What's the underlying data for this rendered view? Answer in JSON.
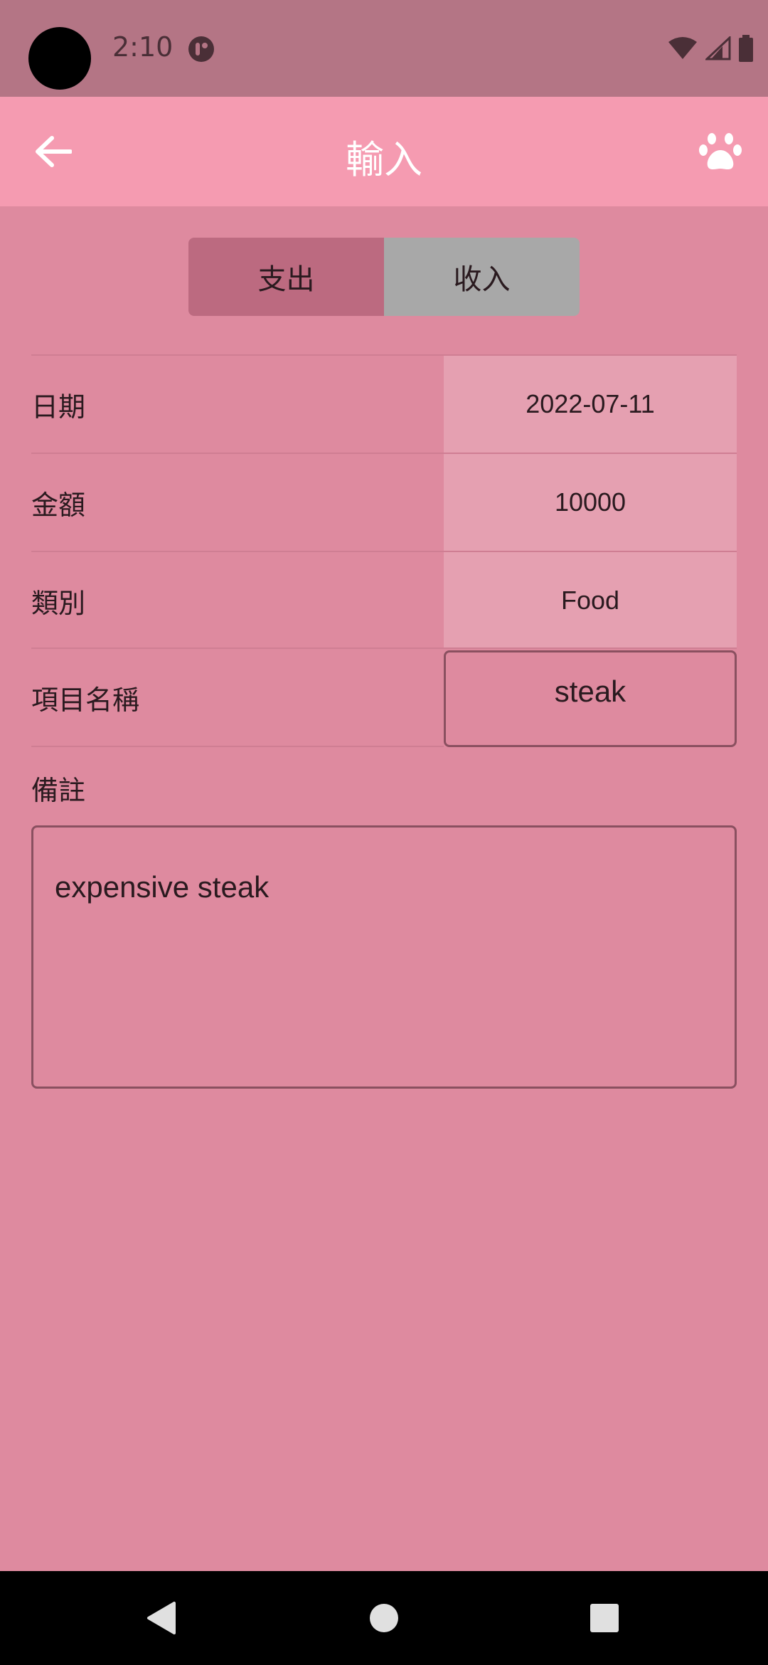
{
  "status_bar": {
    "time": "2:10"
  },
  "app_bar": {
    "title": "輸入",
    "back_icon": "arrow-left-icon",
    "right_icon": "paw-icon"
  },
  "segment": {
    "options": [
      "支出",
      "收入"
    ],
    "selected": "支出"
  },
  "form": {
    "rows": [
      {
        "label": "日期",
        "value": "2022-07-11"
      },
      {
        "label": "金額",
        "value": "10000"
      },
      {
        "label": "類別",
        "value": "Food"
      },
      {
        "label": "項目名稱",
        "value": "steak"
      }
    ],
    "note_label": "備註",
    "note_value": "expensive steak"
  },
  "colors": {
    "status_bar": "#b47585",
    "app_bar": "#f59bb1",
    "background": "#de8a9f",
    "segment_active": "#bc6a80",
    "segment_inactive": "#a8a8a8",
    "value_cell": "#e5a0b1"
  }
}
